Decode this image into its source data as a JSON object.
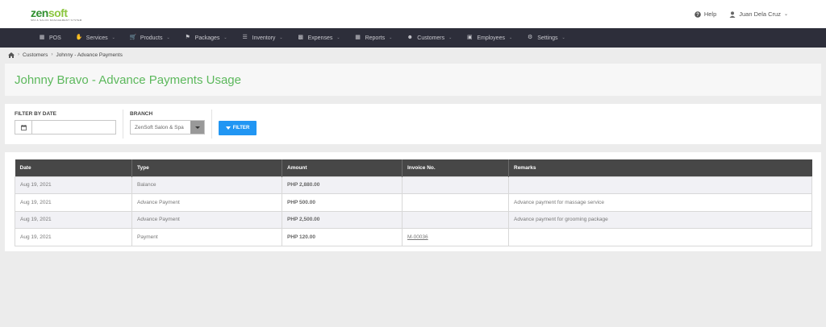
{
  "header": {
    "logo": {
      "zen": "zen",
      "soft": "soft",
      "tagline": "SPA & SALON MANAGEMENT SYSTEM"
    },
    "help_label": "Help",
    "user_name": "Juan Dela Cruz"
  },
  "nav": {
    "items": [
      {
        "label": "POS",
        "icon": "pos-icon"
      },
      {
        "label": "Services",
        "icon": "hand-icon"
      },
      {
        "label": "Products",
        "icon": "cart-icon"
      },
      {
        "label": "Packages",
        "icon": "tags-icon"
      },
      {
        "label": "Inventory",
        "icon": "list-icon"
      },
      {
        "label": "Expenses",
        "icon": "expenses-icon"
      },
      {
        "label": "Reports",
        "icon": "chart-icon"
      },
      {
        "label": "Customers",
        "icon": "users-icon"
      },
      {
        "label": "Employees",
        "icon": "briefcase-icon"
      },
      {
        "label": "Settings",
        "icon": "gear-icon"
      }
    ]
  },
  "breadcrumb": {
    "customers": "Customers",
    "current": "Johnny - Advance Payments"
  },
  "page": {
    "title": "Johnny Bravo - Advance Payments Usage"
  },
  "filters": {
    "date_label": "FILTER BY DATE",
    "date_value": "",
    "branch_label": "BRANCH",
    "branch_value": "ZenSoft Salon & Spa",
    "filter_button": "FILTER"
  },
  "table": {
    "headers": [
      "Date",
      "Type",
      "Amount",
      "Invoice No.",
      "Remarks"
    ],
    "rows": [
      {
        "date": "Aug 19, 2021",
        "type": "Balance",
        "amount": "PHP 2,880.00",
        "invoice": "",
        "remarks": ""
      },
      {
        "date": "Aug 19, 2021",
        "type": "Advance Payment",
        "amount": "PHP 500.00",
        "invoice": "",
        "remarks": "Advance payment for massage service"
      },
      {
        "date": "Aug 19, 2021",
        "type": "Advance Payment",
        "amount": "PHP 2,500.00",
        "invoice": "",
        "remarks": "Advance payment for grooming package"
      },
      {
        "date": "Aug 19, 2021",
        "type": "Payment",
        "amount": "PHP 120.00",
        "invoice": "M-00036",
        "remarks": ""
      }
    ]
  }
}
